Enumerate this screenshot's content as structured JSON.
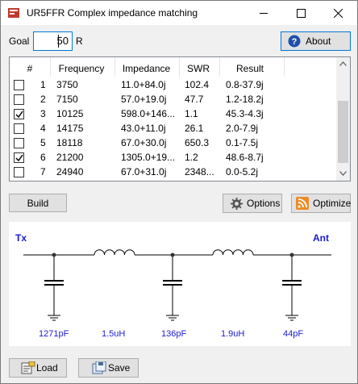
{
  "window": {
    "title": "UR5FFR Complex impedance matching"
  },
  "goal": {
    "label": "Goal",
    "value": "50",
    "unit": "R"
  },
  "buttons": {
    "about": "About",
    "build": "Build",
    "options": "Options",
    "optimize": "Optimize",
    "load": "Load",
    "save": "Save"
  },
  "table": {
    "columns": [
      "#",
      "Frequency",
      "Impedance",
      "SWR",
      "Result"
    ],
    "rows": [
      {
        "checked": false,
        "num": "1",
        "freq": "3750",
        "imp": "11.0+84.0j",
        "swr": "102.4",
        "result": "0.8-37.9j"
      },
      {
        "checked": false,
        "num": "2",
        "freq": "7150",
        "imp": "57.0+19.0j",
        "swr": "47.7",
        "result": "1.2-18.2j"
      },
      {
        "checked": true,
        "num": "3",
        "freq": "10125",
        "imp": "598.0+146...",
        "swr": "1.1",
        "result": "45.3-4.3j"
      },
      {
        "checked": false,
        "num": "4",
        "freq": "14175",
        "imp": "43.0+11.0j",
        "swr": "26.1",
        "result": "2.0-7.9j"
      },
      {
        "checked": false,
        "num": "5",
        "freq": "18118",
        "imp": "67.0+30.0j",
        "swr": "650.3",
        "result": "0.1-7.5j"
      },
      {
        "checked": true,
        "num": "6",
        "freq": "21200",
        "imp": "1305.0+19...",
        "swr": "1.2",
        "result": "48.6-8.7j"
      },
      {
        "checked": false,
        "num": "7",
        "freq": "24940",
        "imp": "67.0+31.0j",
        "swr": "2348...",
        "result": "0.0-5.2j"
      }
    ]
  },
  "schematic": {
    "tx": "Tx",
    "ant": "Ant",
    "components": {
      "c1": "1271pF",
      "l1": "1.5uH",
      "c2": "136pF",
      "l2": "1.9uH",
      "c3": "44pF"
    },
    "color": "#1a1ad6"
  },
  "icons": [
    "app-icon",
    "minimize-icon",
    "maximize-icon",
    "close-icon",
    "help-icon",
    "gear-icon",
    "rss-icon",
    "load-icon",
    "save-icon"
  ]
}
